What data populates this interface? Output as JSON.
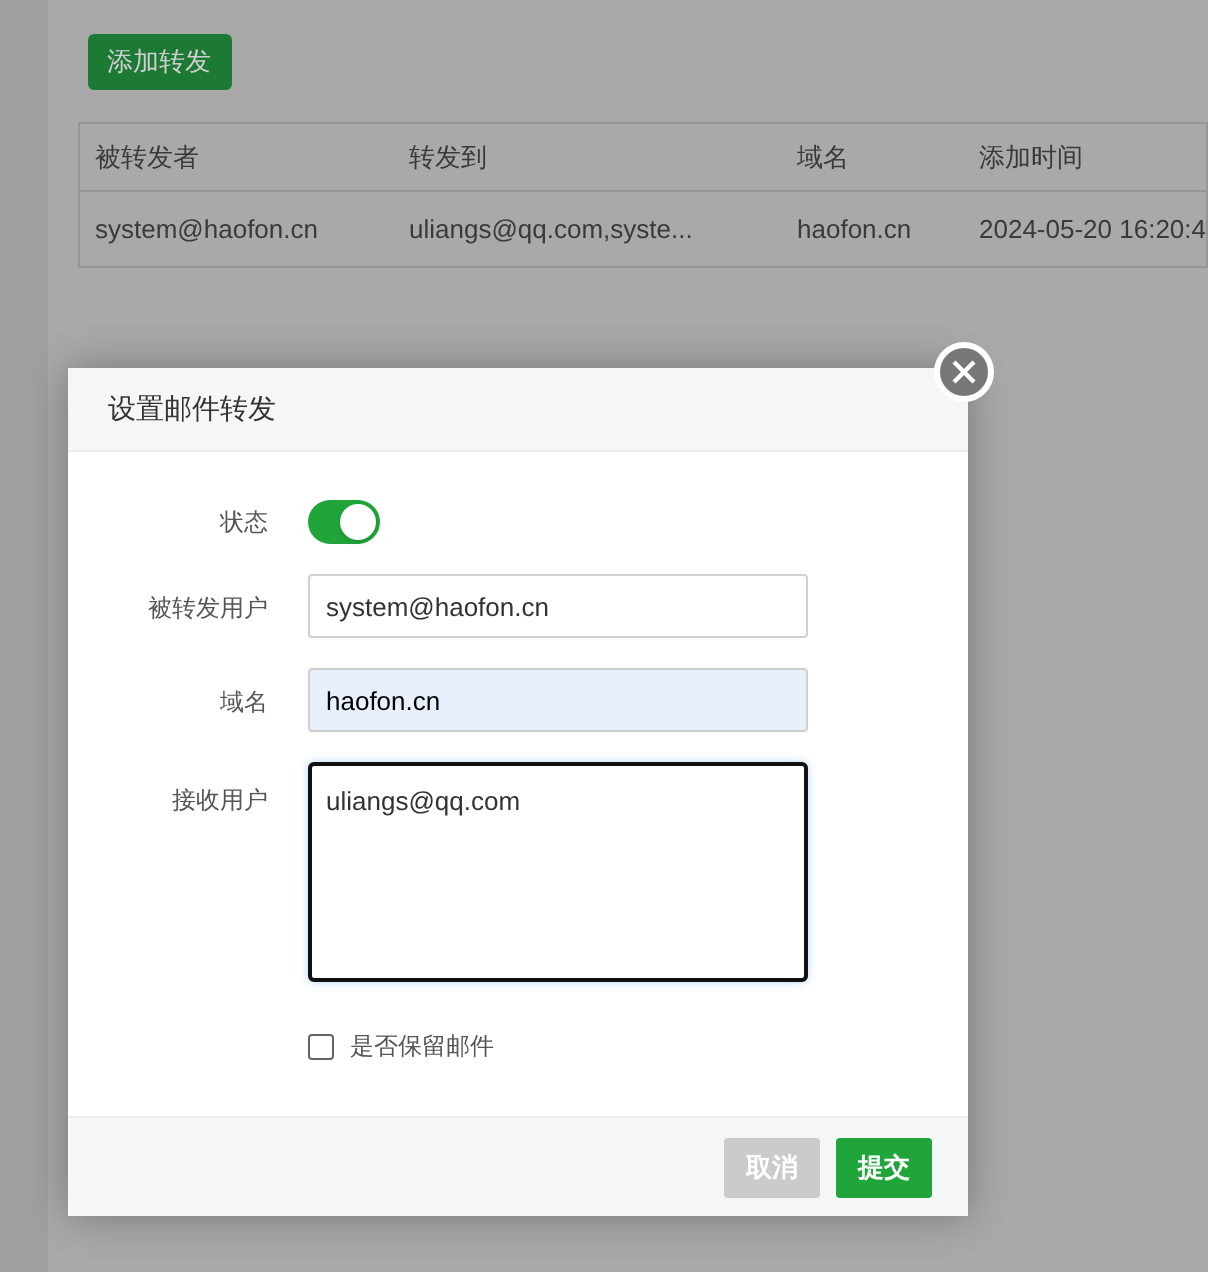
{
  "toolbar": {
    "add_button": "添加转发"
  },
  "table": {
    "columns": [
      "被转发者",
      "转发到",
      "域名",
      "添加时间"
    ],
    "rows": [
      [
        "system@haofon.cn",
        "uliangs@qq.com,syste...",
        "haofon.cn",
        "2024-05-20 16:20:4"
      ]
    ]
  },
  "dialog": {
    "title": "设置邮件转发",
    "status": {
      "label": "状态",
      "on": true
    },
    "fields": [
      {
        "label": "被转发用户",
        "value": "system@haofon.cn",
        "kind": "input",
        "autofilled": false
      },
      {
        "label": "域名",
        "value": "haofon.cn",
        "kind": "input",
        "autofilled": true
      },
      {
        "label": "接收用户",
        "value": "uliangs@qq.com",
        "kind": "textarea",
        "autofilled": false
      }
    ],
    "keep_mail": {
      "label": "是否保留邮件",
      "checked": false
    },
    "buttons": [
      {
        "label": "取消",
        "kind": "cancel"
      },
      {
        "label": "提交",
        "kind": "submit"
      }
    ]
  }
}
